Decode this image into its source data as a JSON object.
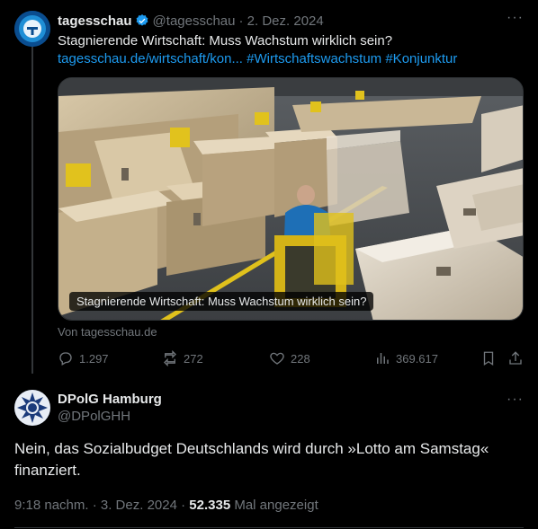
{
  "tweet1": {
    "name": "tagesschau",
    "handle": "@tagesschau",
    "date": "· 2. Dez. 2024",
    "more": "···",
    "text": "Stagnierende Wirtschaft: Muss Wachstum wirklich sein? ",
    "link": "tagesschau.de/wirtschaft/kon...",
    "hashtag1": "#Wirtschaftswachstum",
    "hashtag2": "#Konjunktur",
    "media_caption": "Stagnierende Wirtschaft: Muss Wachstum wirklich sein?",
    "source": "Von tagesschau.de",
    "actions": {
      "replies": "1.297",
      "reposts": "272",
      "likes": "228",
      "views": "369.617"
    }
  },
  "tweet2": {
    "name": "DPolG Hamburg",
    "handle": "@DPolGHH",
    "more": "···",
    "text": "Nein, das Sozialbudget Deutschlands wird durch »Lotto am Samstag« finanziert.",
    "time": "9:18 nachm. · 3. Dez. 2024 · ",
    "views": "52.335",
    "views_label": " Mal angezeigt"
  },
  "colors": {
    "background": "#000000",
    "text": "#e7e9ea",
    "muted": "#71767b",
    "link": "#1d9bf0",
    "verified": "#1d9bf0"
  }
}
